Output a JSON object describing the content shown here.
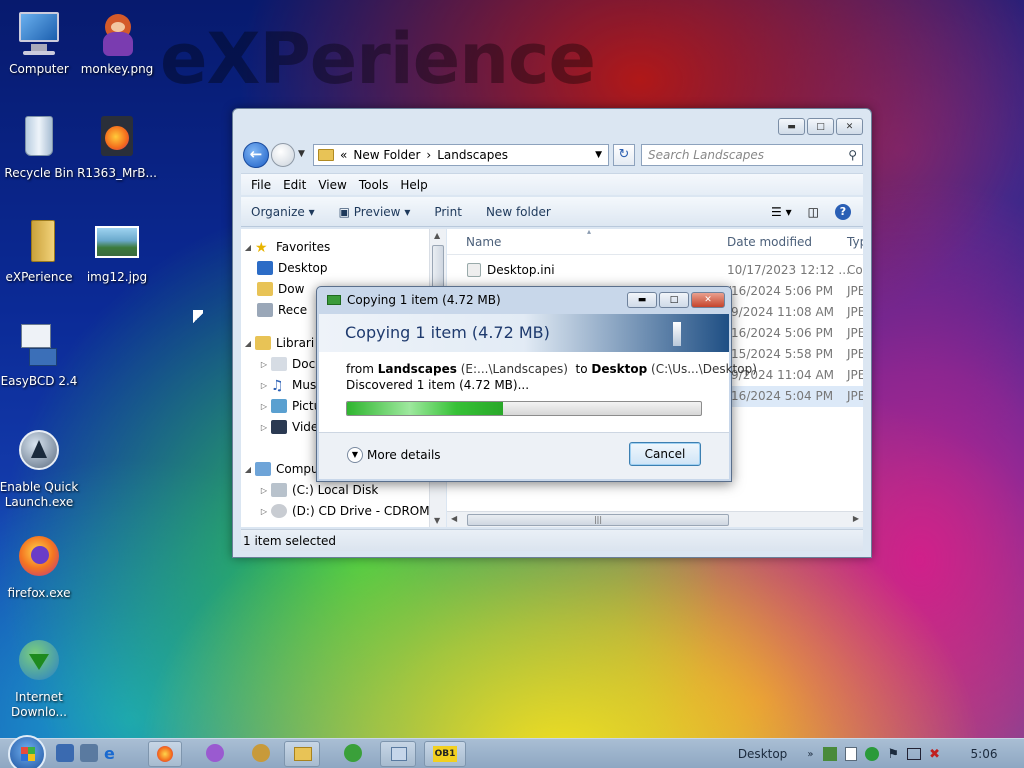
{
  "desktop": {
    "brand": "eXPerience",
    "icons": [
      {
        "label": "Computer"
      },
      {
        "label": "monkey.png"
      },
      {
        "label": "Recycle Bin"
      },
      {
        "label": "R1363_MrB..."
      },
      {
        "label": "eXPerience"
      },
      {
        "label": "img12.jpg"
      },
      {
        "label": "EasyBCD 2.4"
      },
      {
        "label": "Enable Quick Launch.exe"
      },
      {
        "label": "firefox.exe"
      },
      {
        "label": "Internet Downlo..."
      }
    ]
  },
  "explorer": {
    "address": {
      "prefix": "«",
      "crumb1": "New Folder",
      "separator": "›",
      "crumb2": "Landscapes"
    },
    "search_placeholder": "Search Landscapes",
    "menu": [
      "File",
      "Edit",
      "View",
      "Tools",
      "Help"
    ],
    "toolbar": {
      "organize": "Organize",
      "preview": "Preview",
      "print": "Print",
      "new_folder": "New folder"
    },
    "nav": [
      {
        "label": "Favorites"
      },
      {
        "label": "Desktop"
      },
      {
        "label": "Dow"
      },
      {
        "label": "Rece"
      },
      {
        "label": "Librari"
      },
      {
        "label": "Docu"
      },
      {
        "label": "Musi"
      },
      {
        "label": "Pictu"
      },
      {
        "label": "Vide"
      },
      {
        "label": "Compu"
      },
      {
        "label": "(C:) Local Disk"
      },
      {
        "label": "(D:) CD Drive - CDROM"
      }
    ],
    "columns": {
      "name": "Name",
      "date": "Date modified",
      "type": "Typ"
    },
    "files": [
      {
        "name": "Desktop.ini",
        "date": "10/17/2023 12:12 ...",
        "type": "Cor"
      },
      {
        "name": "",
        "date": "/16/2024 5:06 PM",
        "type": "JPE"
      },
      {
        "name": "",
        "date": "/9/2024 11:08 AM",
        "type": "JPE"
      },
      {
        "name": "",
        "date": "/16/2024 5:06 PM",
        "type": "JPE"
      },
      {
        "name": "",
        "date": "/15/2024 5:58 PM",
        "type": "JPE"
      },
      {
        "name": "",
        "date": "/9/2024 11:04 AM",
        "type": "JPE"
      },
      {
        "name": "",
        "date": "/16/2024 5:04 PM",
        "type": "JPE"
      }
    ],
    "hscroll_grip": "|||",
    "status": "1 item selected"
  },
  "copy_dialog": {
    "title": "Copying 1 item (4.72 MB)",
    "heading": "Copying 1 item (4.72 MB)",
    "from_word": "from",
    "from_name": "Landscapes",
    "from_path": "(E:...\\Landscapes)",
    "to_word": "to",
    "to_name": "Desktop",
    "to_path": "(C:\\Us...\\Desktop)",
    "discovered": "Discovered 1 item (4.72 MB)...",
    "progress": 0.44,
    "more_details": "More details",
    "cancel": "Cancel"
  },
  "taskbar": {
    "task_label": "OB1",
    "tray_desktop": "Desktop",
    "clock": "5:06"
  }
}
